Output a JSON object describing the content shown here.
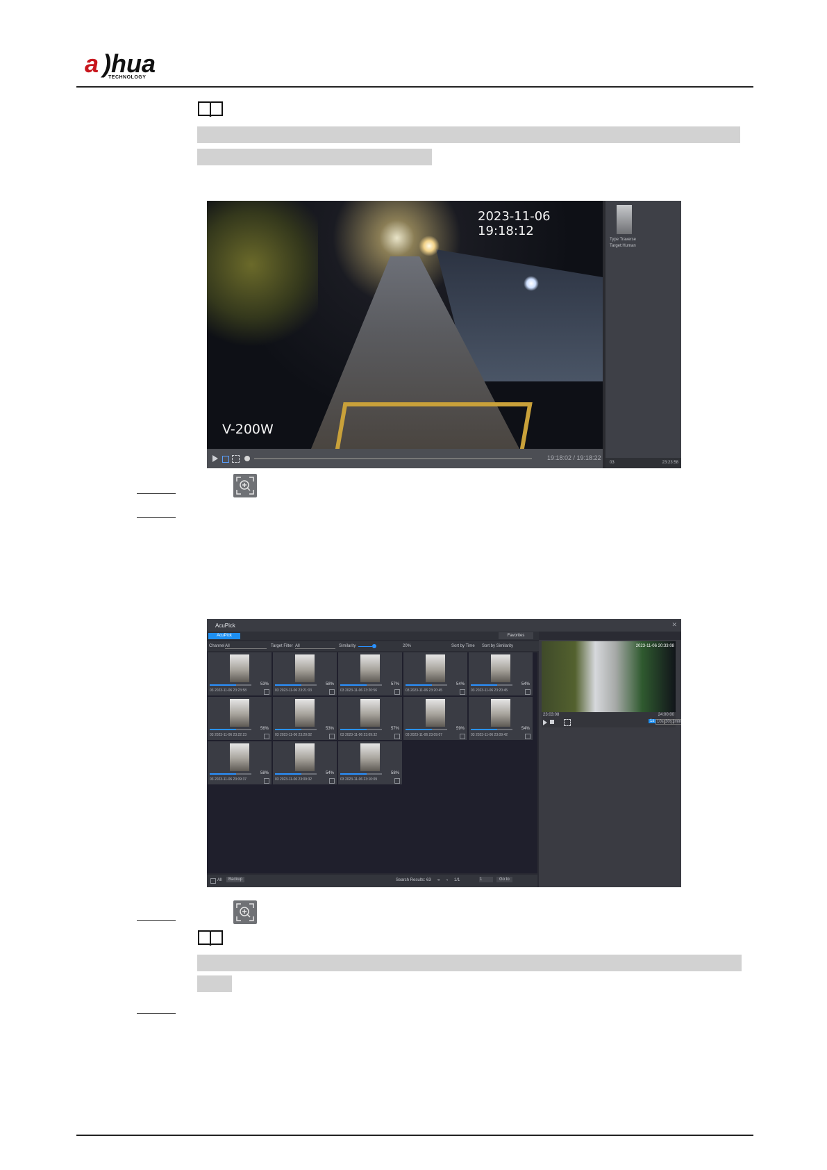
{
  "header": {
    "logo_text": "alhua",
    "logo_subtext": "TECHNOLOGY"
  },
  "screenshot1": {
    "osd_time": "2023-11-06 19:18:12",
    "osd_camera": "V-200W",
    "playback_time": "19:18:02 / 19:18:22",
    "side_type": "Type Traverse",
    "side_target": "Target:Human",
    "side_bottom_left": "03",
    "side_bottom_right": "23:23:58"
  },
  "screenshot2": {
    "title": "AcuPick",
    "tab": "AcuPick",
    "favorites": "Favorites",
    "filters": {
      "channel_label": "Channel",
      "channel_value": "All",
      "target_label": "Target Filter",
      "target_value": "All",
      "similarity_label": "Similarity",
      "similarity_value": "20%",
      "sort_time": "Sort by Time",
      "sort_similarity": "Sort by Similarity"
    },
    "cards": [
      {
        "pct": "53%",
        "ts": "03 2023-11-06 23:23:58"
      },
      {
        "pct": "58%",
        "ts": "03 2023-11-06 23:21:03"
      },
      {
        "pct": "57%",
        "ts": "03 2023-11-06 23:20:56"
      },
      {
        "pct": "54%",
        "ts": "03 2023-11-06 23:20:45"
      },
      {
        "pct": "54%",
        "ts": "03 2023-11-06 23:20:45"
      },
      {
        "pct": "56%",
        "ts": "03 2023-11-06 23:22:23"
      },
      {
        "pct": "53%",
        "ts": "03 2023-11-06 23:20:02"
      },
      {
        "pct": "57%",
        "ts": "03 2023-11-06 23:09:32"
      },
      {
        "pct": "59%",
        "ts": "03 2023-11-06 23:09:07"
      },
      {
        "pct": "54%",
        "ts": "03 2023-11-06 23:09:42"
      },
      {
        "pct": "58%",
        "ts": "03 2023-11-06 23:09:37"
      },
      {
        "pct": "54%",
        "ts": "03 2023-11-06 23:09:32"
      },
      {
        "pct": "58%",
        "ts": "03 2023-11-06 23:10:09"
      }
    ],
    "bottom": {
      "all": "All",
      "backup": "Backup",
      "results": "Search Results: 63",
      "page": "1/1",
      "page_input": "1",
      "go": "Go to"
    },
    "right_video_time": "2023-11-06 20:33:08",
    "speeds": [
      "1s",
      "10s",
      "30s",
      "1min"
    ],
    "right_times": [
      "23:03:08",
      "24:00:00"
    ]
  }
}
